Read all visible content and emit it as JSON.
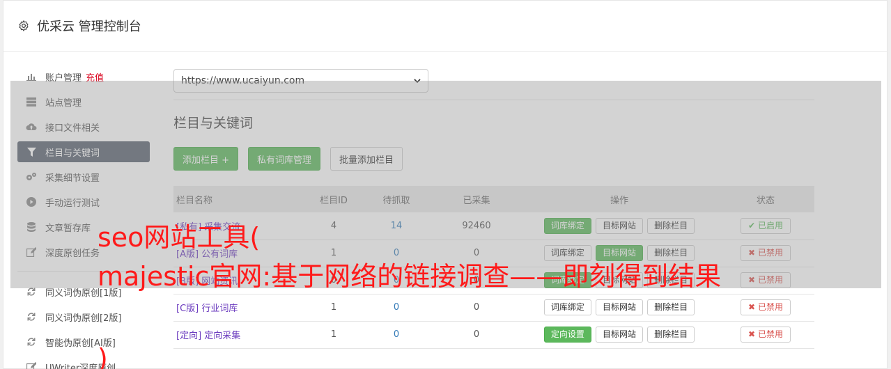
{
  "header": {
    "title": "优采云 管理控制台",
    "icon": "gear-icon"
  },
  "sidebar": {
    "items": [
      {
        "label": "账户管理",
        "extra": "充值",
        "icon": "bar-chart-icon"
      },
      {
        "label": "站点管理",
        "icon": "server-icon"
      },
      {
        "label": "接口文件相关",
        "icon": "cloud-upload-icon"
      },
      {
        "label": "栏目与关键词",
        "icon": "filter-icon",
        "active": true
      },
      {
        "label": "采集细节设置",
        "icon": "cogs-icon"
      },
      {
        "label": "手动运行测试",
        "icon": "play-circle-icon"
      },
      {
        "label": "文章暂存库",
        "icon": "database-icon"
      },
      {
        "label": "深度原创任务",
        "icon": "edit-icon"
      }
    ],
    "items2": [
      {
        "label": "同义词伪原创[1版]",
        "icon": "refresh-icon"
      },
      {
        "label": "同义词伪原创[2版]",
        "icon": "refresh-icon"
      },
      {
        "label": "智能伪原创[AI版]",
        "icon": "refresh-icon"
      },
      {
        "label": "UWriter深度原创",
        "icon": "edit-icon"
      }
    ]
  },
  "main": {
    "site_select": "https://www.ucaiyun.com",
    "section_title": "栏目与关键词",
    "buttons": {
      "add": "添加栏目 +",
      "private_lib": "私有词库管理",
      "batch_add": "批量添加栏目"
    },
    "table": {
      "headers": [
        "栏目名称",
        "栏目ID",
        "待抓取",
        "已采集",
        "操作",
        "状态"
      ],
      "rows": [
        {
          "name": "[私有] 采集交流",
          "id": "4",
          "pending": "14",
          "collected": "92460",
          "op1": "词库绑定",
          "op2": "目标网站",
          "op3": "删除栏目",
          "status": "已启用"
        },
        {
          "name": "[A版] 公有词库",
          "id": "1",
          "pending": "0",
          "collected": "0",
          "op1": "词库绑定",
          "op2": "目标网站",
          "op3": "删除栏目",
          "status": "已禁用"
        },
        {
          "name": "[B版] 网站资讯",
          "id": "0",
          "pending": "0",
          "collected": "0",
          "op1": "词库绑定",
          "op2": "目标网站",
          "op3": "删除栏目",
          "status": "已禁用"
        },
        {
          "name": "[C版] 行业词库",
          "id": "1",
          "pending": "0",
          "collected": "0",
          "op1": "词库绑定",
          "op2": "目标网站",
          "op3": "删除栏目",
          "status": "已禁用"
        },
        {
          "name": "[定向] 定向采集",
          "id": "1",
          "pending": "0",
          "collected": "0",
          "op1": "定向设置",
          "op2": "目标网站",
          "op3": "删除栏目",
          "status": "已禁用"
        }
      ]
    }
  },
  "overlay_text": {
    "line1": "seo网站工具(",
    "line2": "majestic官网:基于网络的链接调查——即刻得到结果",
    "line3": ")"
  },
  "colors": {
    "accent_green": "#5cb85c",
    "active_nav": "#5a6270",
    "overlay_text": "#ff1a1a",
    "danger": "#d9534f"
  }
}
